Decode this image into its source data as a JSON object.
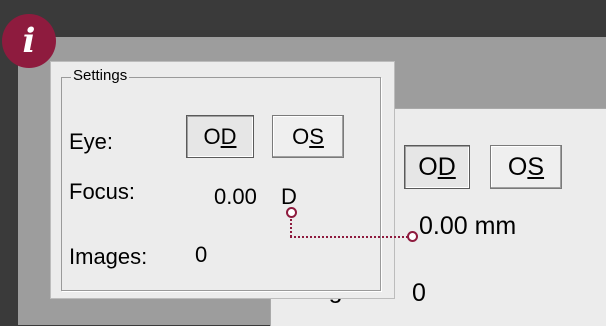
{
  "info_badge": {
    "glyph": "i"
  },
  "front_panel": {
    "group_title": "Settings",
    "eye_label": "Eye:",
    "od_label_prefix": "O",
    "od_label_mnemonic": "D",
    "os_label_prefix": "O",
    "os_label_mnemonic": "S",
    "focus_label": "Focus:",
    "focus_value": "0.00",
    "focus_unit": "D",
    "images_label": "Images:",
    "images_value": "0"
  },
  "back_panel": {
    "od_label_prefix": "O",
    "od_label_mnemonic": "D",
    "os_label_prefix": "O",
    "os_label_mnemonic": "S",
    "focus_value": "0.00 mm",
    "images_label_partial": "Images:",
    "images_value": "0"
  },
  "colors": {
    "accent": "#8e1b3e",
    "panel_bg": "#ececec",
    "backdrop": "#3a3a3a"
  }
}
